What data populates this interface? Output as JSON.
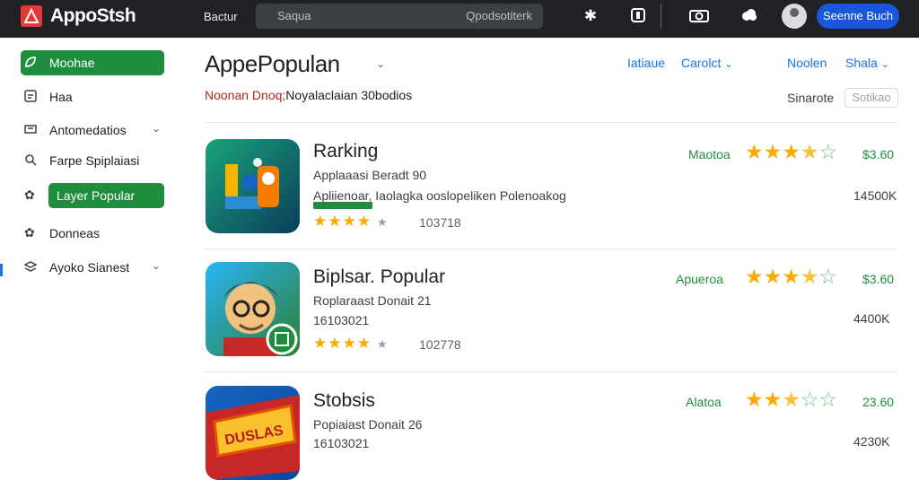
{
  "topbar": {
    "logo": "AppoStsh",
    "link": "Bactur",
    "search_placeholder": "Saqua",
    "search_hint": "Qpodsotiterk",
    "signin": "Seenne Buch"
  },
  "sidebar": {
    "items": [
      {
        "label": "Moohae",
        "icon": "leaf-icon"
      },
      {
        "label": "Haa",
        "icon": "image-icon"
      },
      {
        "label": "Antomedatios",
        "icon": "ticket-icon"
      },
      {
        "label": "Farpe Spiplaiasi",
        "icon": "search-icon"
      },
      {
        "label": "Layer Popular",
        "icon": "gear-icon"
      },
      {
        "label": "Donneas",
        "icon": "cog-icon"
      },
      {
        "label": "Ayoko Sianest",
        "icon": "layers-icon"
      }
    ]
  },
  "header": {
    "title": "AppePopulan",
    "subtitle_accent": "Noonan Dnoq;",
    "subtitle_rest": "Noyalaclaian 30bodios",
    "filters": [
      "Iatiaue",
      "Carolct",
      "Noolen",
      "Shala"
    ],
    "sort_label": "Sinarote",
    "sort_value": "Sotikao"
  },
  "apps": [
    {
      "name": "Rarking",
      "line1": "Applaaasi Beradt 90",
      "line2": "Apliienoar, Iaolagka ooslopeliken Polenoakog",
      "mini_stars": "★★★★",
      "mini_dim": "★",
      "mini_count": "103718",
      "category": "Maotoa",
      "stars": [
        1,
        1,
        1,
        0.5,
        0
      ],
      "price": "$3.60",
      "downloads": "14500K"
    },
    {
      "name": "Biplsar. Popular",
      "line1": "Roplaraast Donait 21",
      "line2": "16103021",
      "mini_stars": "★★★★",
      "mini_dim": "★",
      "mini_count": "102778",
      "category": "Apueroa",
      "stars": [
        1,
        1,
        1,
        0.5,
        0
      ],
      "price": "$3.60",
      "downloads": "4400K"
    },
    {
      "name": "Stobsis",
      "line1": "Popiaiast Donait 26",
      "line2": "16103021",
      "mini_stars": "★★★★",
      "mini_dim": "★",
      "mini_count": "",
      "category": "Alatoa",
      "stars": [
        1,
        1,
        0.5,
        0,
        0
      ],
      "price": "23.60",
      "downloads": "4230K"
    }
  ],
  "colors": {
    "topbar": "#202124",
    "accent_green": "#1e8e3e",
    "accent_blue": "#1a56db",
    "star": "#f9ab00"
  }
}
